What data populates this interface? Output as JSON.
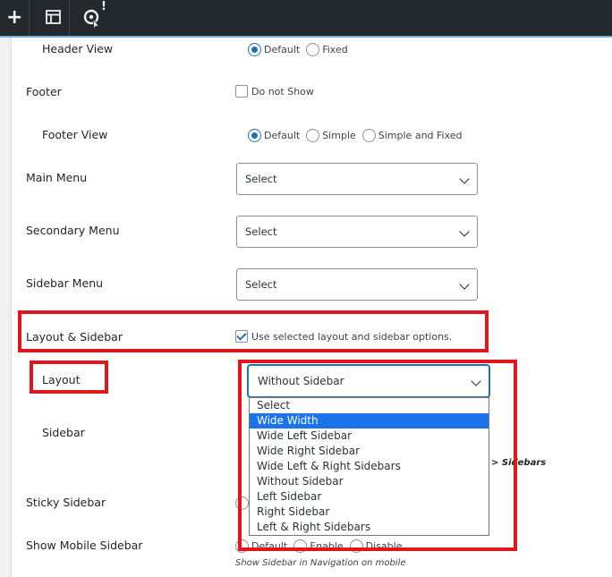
{
  "toolbar": {
    "icons": [
      "plus-icon",
      "layout-icon",
      "plugin-alert-icon"
    ],
    "plus_glyph": "+",
    "alert_glyph": "!"
  },
  "form": {
    "header_view": {
      "label": "Header View",
      "options": [
        "Default",
        "Fixed"
      ],
      "selected": "Default"
    },
    "footer": {
      "label": "Footer",
      "checkbox_label": "Do not Show",
      "checked": false
    },
    "footer_view": {
      "label": "Footer View",
      "options": [
        "Default",
        "Simple",
        "Simple and Fixed"
      ],
      "selected": "Default"
    },
    "main_menu": {
      "label": "Main Menu",
      "value": "Select"
    },
    "secondary_menu": {
      "label": "Secondary Menu",
      "value": "Select"
    },
    "sidebar_menu": {
      "label": "Sidebar Menu",
      "value": "Select"
    },
    "layout_sidebar": {
      "label": "Layout & Sidebar",
      "checkbox_label": "Use selected layout and sidebar options.",
      "checked": true
    },
    "layout": {
      "label": "Layout",
      "value": "Without Sidebar",
      "options": [
        "Select",
        "Wide Width",
        "Wide Left Sidebar",
        "Wide Right Sidebar",
        "Wide Left & Right Sidebars",
        "Without Sidebar",
        "Left Sidebar",
        "Right Sidebar",
        "Left & Right Sidebars"
      ],
      "highlighted": "Wide Width"
    },
    "sidebar": {
      "label": "Sidebar",
      "hint_fragment": "> Sidebars"
    },
    "sticky_sidebar": {
      "label": "Sticky Sidebar"
    },
    "show_mobile_sidebar": {
      "label": "Show Mobile Sidebar",
      "options": [
        "Default",
        "Enable",
        "Disable"
      ],
      "hint": "Show Sidebar in Navigation on mobile"
    }
  },
  "colors": {
    "accent": "#2271b1",
    "highlight": "#e0161d",
    "topbar": "#23282d"
  }
}
